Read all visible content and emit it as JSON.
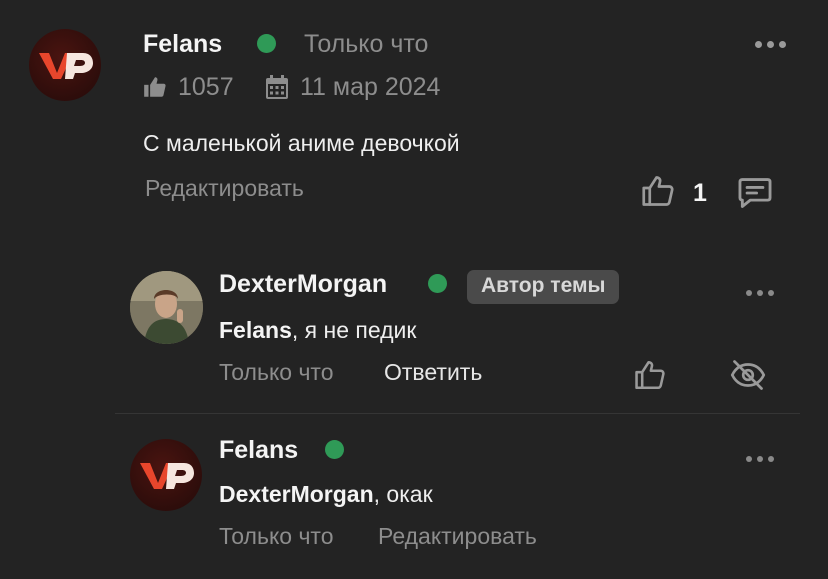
{
  "comment": {
    "author": "Felans",
    "time": "Только что",
    "likes_count": "1057",
    "date": "11 мар 2024",
    "text": "С маленькой аниме девочкой",
    "edit_label": "Редактировать",
    "reaction_count": "1",
    "avatar_letters": "VP"
  },
  "reply1": {
    "author": "DexterMorgan",
    "badge": "Автор темы",
    "mention": "Felans",
    "text": ", я не педик",
    "time": "Только что",
    "reply_label": "Ответить"
  },
  "reply2": {
    "author": "Felans",
    "mention": "DexterMorgan",
    "text": ", окак",
    "time": "Только что",
    "edit_label": "Редактировать",
    "avatar_letters": "VP"
  },
  "colors": {
    "background": "#232323",
    "online": "#2f9a57",
    "brand_red": "#e2452b"
  }
}
